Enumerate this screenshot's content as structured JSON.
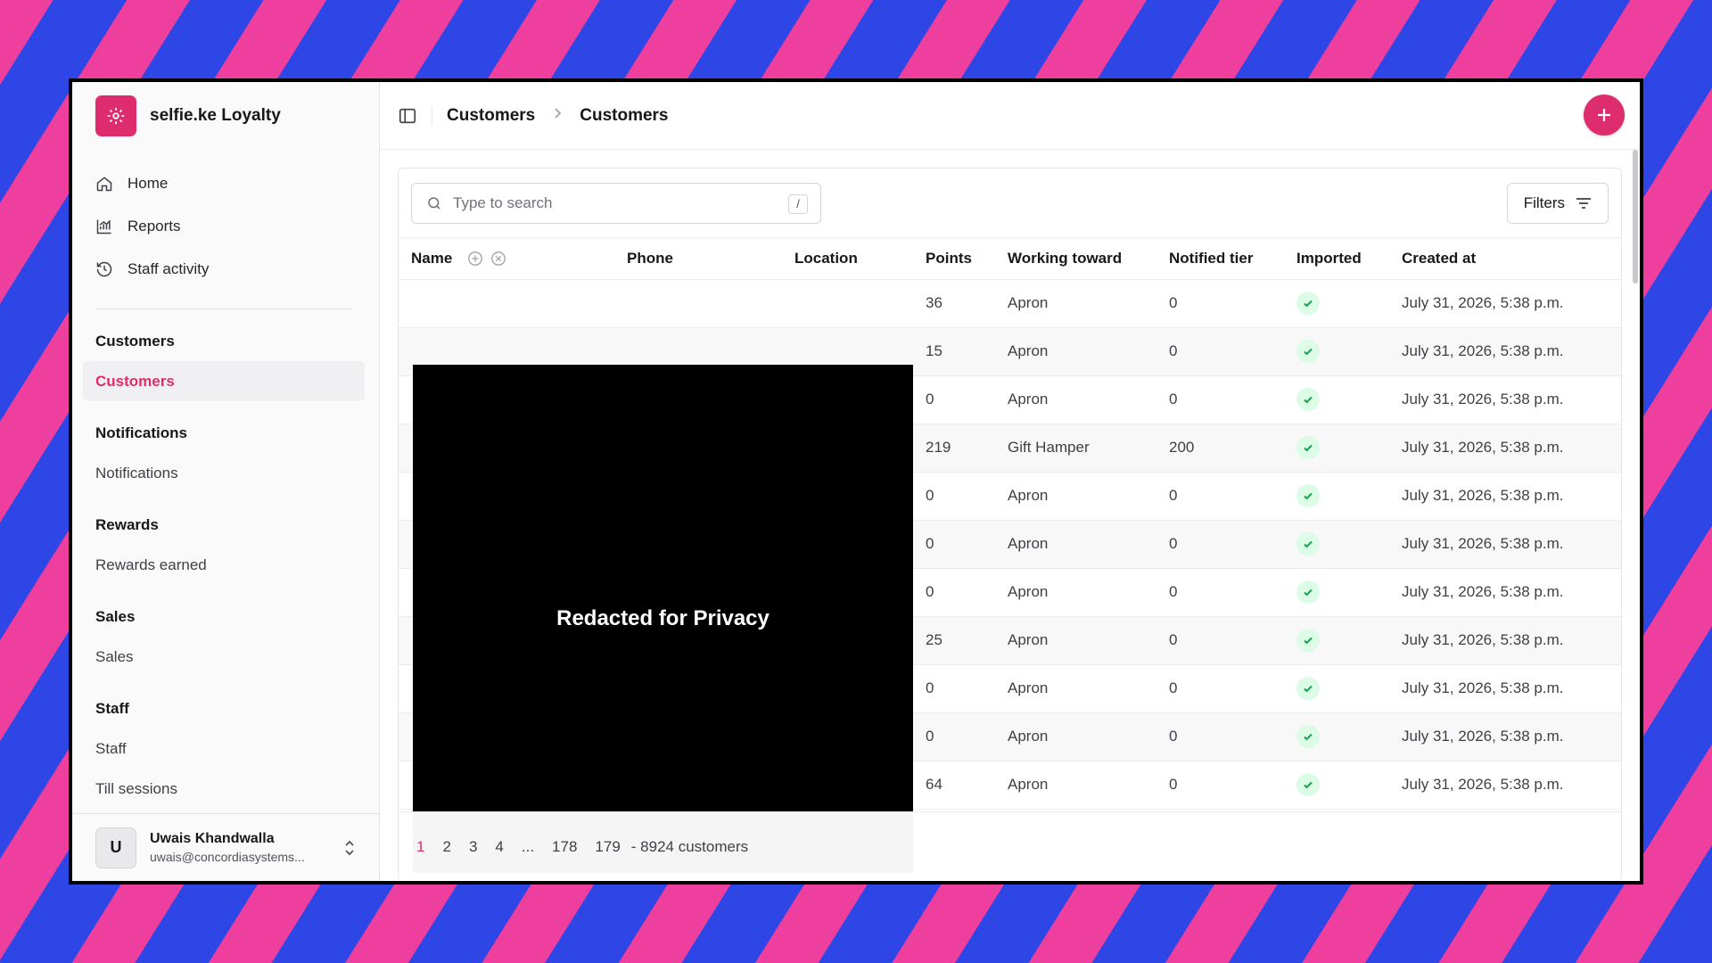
{
  "app": {
    "name": "selfie.ke Loyalty"
  },
  "nav": {
    "top": [
      {
        "label": "Home",
        "icon": "home-icon"
      },
      {
        "label": "Reports",
        "icon": "chart-icon"
      },
      {
        "label": "Staff activity",
        "icon": "history-icon"
      }
    ],
    "sections": [
      {
        "title": "Customers",
        "items": [
          "Customers"
        ]
      },
      {
        "title": "Notifications",
        "items": [
          "Notifications"
        ]
      },
      {
        "title": "Rewards",
        "items": [
          "Rewards earned"
        ]
      },
      {
        "title": "Sales",
        "items": [
          "Sales"
        ]
      },
      {
        "title": "Staff",
        "items": [
          "Staff",
          "Till sessions"
        ]
      }
    ]
  },
  "user": {
    "initial": "U",
    "name": "Uwais Khandwalla",
    "email": "uwais@concordiasystems..."
  },
  "breadcrumb": [
    "Customers",
    "Customers"
  ],
  "search": {
    "placeholder": "Type to search",
    "shortcut": "/"
  },
  "filters_label": "Filters",
  "table": {
    "columns": [
      "Name",
      "Phone",
      "Location",
      "Points",
      "Working toward",
      "Notified tier",
      "Imported",
      "Created at"
    ],
    "rows": [
      {
        "points": "36",
        "working_toward": "Apron",
        "notified_tier": "0",
        "created_at": "July 31, 2026, 5:38 p.m."
      },
      {
        "points": "15",
        "working_toward": "Apron",
        "notified_tier": "0",
        "created_at": "July 31, 2026, 5:38 p.m."
      },
      {
        "points": "0",
        "working_toward": "Apron",
        "notified_tier": "0",
        "created_at": "July 31, 2026, 5:38 p.m."
      },
      {
        "points": "219",
        "working_toward": "Gift Hamper",
        "notified_tier": "200",
        "created_at": "July 31, 2026, 5:38 p.m."
      },
      {
        "points": "0",
        "working_toward": "Apron",
        "notified_tier": "0",
        "created_at": "July 31, 2026, 5:38 p.m."
      },
      {
        "points": "0",
        "working_toward": "Apron",
        "notified_tier": "0",
        "created_at": "July 31, 2026, 5:38 p.m."
      },
      {
        "points": "0",
        "working_toward": "Apron",
        "notified_tier": "0",
        "created_at": "July 31, 2026, 5:38 p.m."
      },
      {
        "points": "25",
        "working_toward": "Apron",
        "notified_tier": "0",
        "created_at": "July 31, 2026, 5:38 p.m."
      },
      {
        "points": "0",
        "working_toward": "Apron",
        "notified_tier": "0",
        "created_at": "July 31, 2026, 5:38 p.m."
      },
      {
        "points": "0",
        "working_toward": "Apron",
        "notified_tier": "0",
        "created_at": "July 31, 2026, 5:38 p.m."
      },
      {
        "points": "64",
        "working_toward": "Apron",
        "notified_tier": "0",
        "created_at": "July 31, 2026, 5:38 p.m."
      }
    ]
  },
  "redaction_label": "Redacted for Privacy",
  "pagination": {
    "pages": [
      "1",
      "2",
      "3",
      "4",
      "...",
      "178",
      "179"
    ],
    "count": "- 8924 customers"
  },
  "colors": {
    "accent": "#de2d6e",
    "stripe_blue": "#2f46e6",
    "stripe_pink": "#ee3f9e",
    "success_bg": "#dcfce7",
    "success": "#16a34a"
  }
}
